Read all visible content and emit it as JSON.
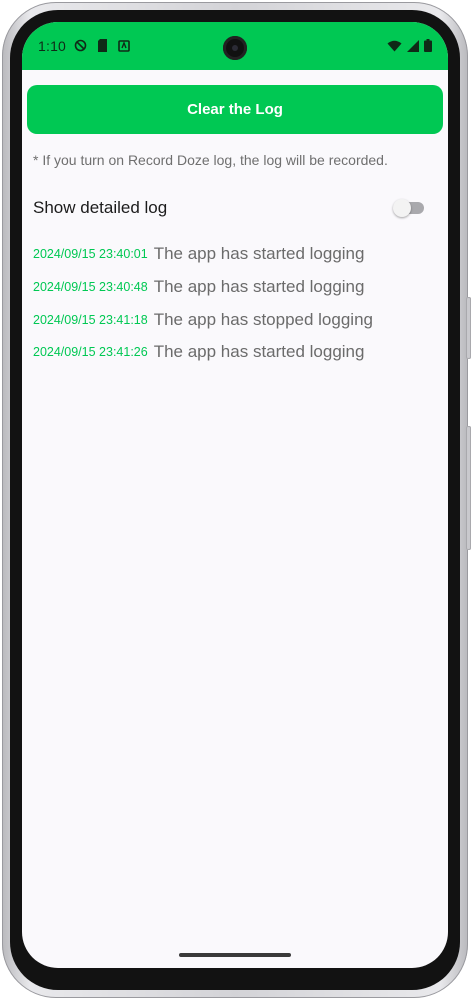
{
  "status_bar": {
    "time": "1:10",
    "icons_left": [
      "do-not-disturb-icon",
      "sd-card-icon",
      "app-notification-icon"
    ],
    "icons_right": [
      "wifi-icon",
      "cellular-signal-icon",
      "battery-icon"
    ]
  },
  "clear_button": {
    "label": "Clear the Log"
  },
  "note": "* If you turn on Record Doze log, the log will be recorded.",
  "detailed_log": {
    "label": "Show detailed log",
    "enabled": false
  },
  "log_entries": [
    {
      "time": "2024/09/15 23:40:01",
      "message": "The app has started logging"
    },
    {
      "time": "2024/09/15 23:40:48",
      "message": "The app has started logging"
    },
    {
      "time": "2024/09/15 23:41:18",
      "message": "The app has stopped logging"
    },
    {
      "time": "2024/09/15 23:41:26",
      "message": "The app has started logging"
    }
  ],
  "colors": {
    "accent": "#00c853",
    "background": "#faf9fc",
    "note_text": "#6f6f6f",
    "log_message_text": "#6b6b6b"
  }
}
